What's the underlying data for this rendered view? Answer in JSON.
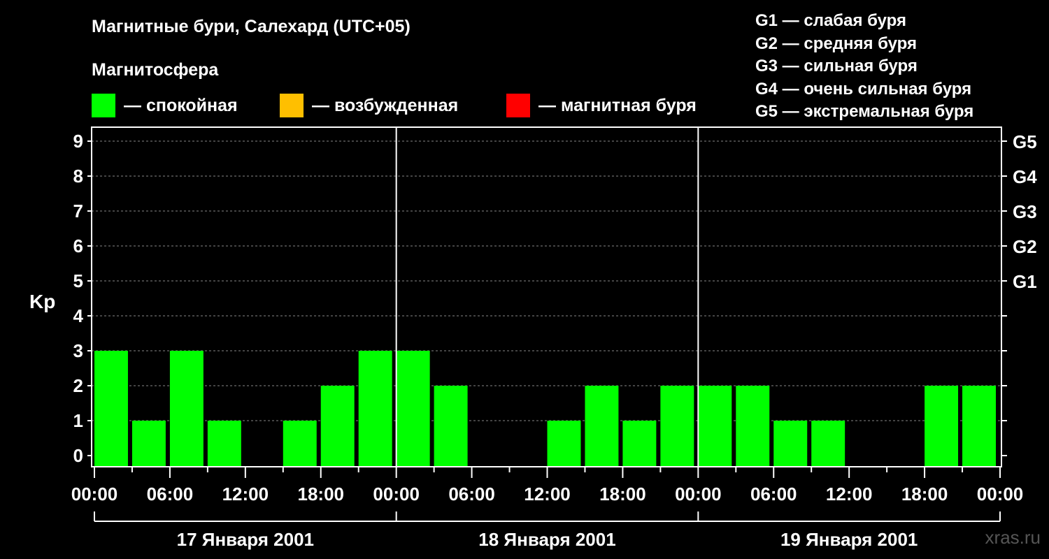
{
  "title": "Магнитные бури, Салехард (UTC+05)",
  "subtitle": "Магнитосфера",
  "legend": [
    {
      "label": "— спокойная",
      "color": "#00ff00"
    },
    {
      "label": "— возбужденная",
      "color": "#ffbf00"
    },
    {
      "label": "— магнитная буря",
      "color": "#ff0000"
    }
  ],
  "g_scale": [
    "G1 — слабая буря",
    "G2 — средняя буря",
    "G3 — сильная буря",
    "G4 — очень сильная буря",
    "G5 — экстремальная буря"
  ],
  "watermark": "xras.ru",
  "chart_data": {
    "type": "bar",
    "ylabel": "Kp",
    "ylim": [
      0,
      9
    ],
    "yticks": [
      "0",
      "1",
      "2",
      "3",
      "4",
      "5",
      "6",
      "7",
      "8",
      "9"
    ],
    "right_ticks": [
      {
        "kp": 5,
        "label": "G1"
      },
      {
        "kp": 6,
        "label": "G2"
      },
      {
        "kp": 7,
        "label": "G3"
      },
      {
        "kp": 8,
        "label": "G4"
      },
      {
        "kp": 9,
        "label": "G5"
      }
    ],
    "xticks": [
      "00:00",
      "06:00",
      "12:00",
      "18:00",
      "00:00",
      "06:00",
      "12:00",
      "18:00",
      "00:00",
      "06:00",
      "12:00",
      "18:00",
      "00:00"
    ],
    "days": [
      "17 Января 2001",
      "18 Января 2001",
      "19 Января 2001"
    ],
    "bar_color": "#00ff00",
    "grid": true,
    "bars": [
      {
        "start": "17 Jan 00:00",
        "kp": 3
      },
      {
        "start": "17 Jan 03:00",
        "kp": 1
      },
      {
        "start": "17 Jan 06:00",
        "kp": 3
      },
      {
        "start": "17 Jan 09:00",
        "kp": 1
      },
      {
        "start": "17 Jan 12:00",
        "kp": 0
      },
      {
        "start": "17 Jan 15:00",
        "kp": 1
      },
      {
        "start": "17 Jan 18:00",
        "kp": 2
      },
      {
        "start": "17 Jan 21:00",
        "kp": 3
      },
      {
        "start": "18 Jan 00:00",
        "kp": 3
      },
      {
        "start": "18 Jan 03:00",
        "kp": 2
      },
      {
        "start": "18 Jan 06:00",
        "kp": 0
      },
      {
        "start": "18 Jan 09:00",
        "kp": 0
      },
      {
        "start": "18 Jan 12:00",
        "kp": 1
      },
      {
        "start": "18 Jan 15:00",
        "kp": 2
      },
      {
        "start": "18 Jan 18:00",
        "kp": 1
      },
      {
        "start": "18 Jan 21:00",
        "kp": 2
      },
      {
        "start": "19 Jan 00:00",
        "kp": 2
      },
      {
        "start": "19 Jan 03:00",
        "kp": 2
      },
      {
        "start": "19 Jan 06:00",
        "kp": 1
      },
      {
        "start": "19 Jan 09:00",
        "kp": 1
      },
      {
        "start": "19 Jan 12:00",
        "kp": 0
      },
      {
        "start": "19 Jan 15:00",
        "kp": 0
      },
      {
        "start": "19 Jan 18:00",
        "kp": 2
      },
      {
        "start": "19 Jan 21:00",
        "kp": 2
      }
    ]
  }
}
